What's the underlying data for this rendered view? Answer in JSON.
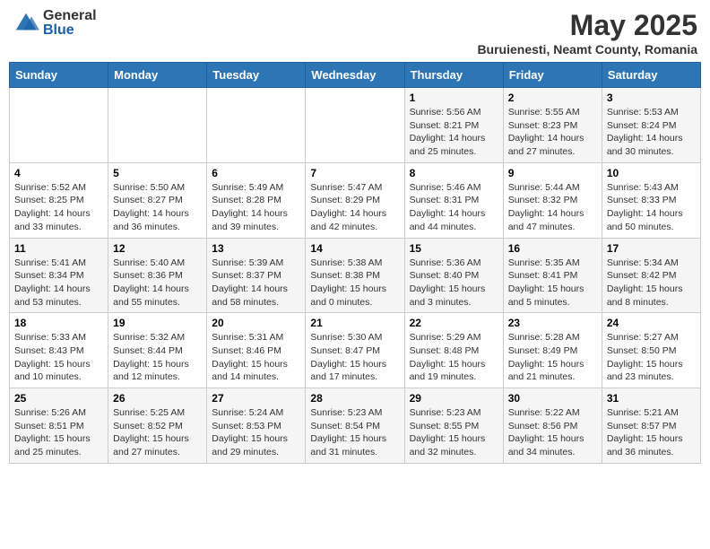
{
  "header": {
    "logo_general": "General",
    "logo_blue": "Blue",
    "month_title": "May 2025",
    "subtitle": "Buruienesti, Neamt County, Romania"
  },
  "days_of_week": [
    "Sunday",
    "Monday",
    "Tuesday",
    "Wednesday",
    "Thursday",
    "Friday",
    "Saturday"
  ],
  "weeks": [
    [
      {
        "day": "",
        "info": ""
      },
      {
        "day": "",
        "info": ""
      },
      {
        "day": "",
        "info": ""
      },
      {
        "day": "",
        "info": ""
      },
      {
        "day": "1",
        "info": "Sunrise: 5:56 AM\nSunset: 8:21 PM\nDaylight: 14 hours\nand 25 minutes."
      },
      {
        "day": "2",
        "info": "Sunrise: 5:55 AM\nSunset: 8:23 PM\nDaylight: 14 hours\nand 27 minutes."
      },
      {
        "day": "3",
        "info": "Sunrise: 5:53 AM\nSunset: 8:24 PM\nDaylight: 14 hours\nand 30 minutes."
      }
    ],
    [
      {
        "day": "4",
        "info": "Sunrise: 5:52 AM\nSunset: 8:25 PM\nDaylight: 14 hours\nand 33 minutes."
      },
      {
        "day": "5",
        "info": "Sunrise: 5:50 AM\nSunset: 8:27 PM\nDaylight: 14 hours\nand 36 minutes."
      },
      {
        "day": "6",
        "info": "Sunrise: 5:49 AM\nSunset: 8:28 PM\nDaylight: 14 hours\nand 39 minutes."
      },
      {
        "day": "7",
        "info": "Sunrise: 5:47 AM\nSunset: 8:29 PM\nDaylight: 14 hours\nand 42 minutes."
      },
      {
        "day": "8",
        "info": "Sunrise: 5:46 AM\nSunset: 8:31 PM\nDaylight: 14 hours\nand 44 minutes."
      },
      {
        "day": "9",
        "info": "Sunrise: 5:44 AM\nSunset: 8:32 PM\nDaylight: 14 hours\nand 47 minutes."
      },
      {
        "day": "10",
        "info": "Sunrise: 5:43 AM\nSunset: 8:33 PM\nDaylight: 14 hours\nand 50 minutes."
      }
    ],
    [
      {
        "day": "11",
        "info": "Sunrise: 5:41 AM\nSunset: 8:34 PM\nDaylight: 14 hours\nand 53 minutes."
      },
      {
        "day": "12",
        "info": "Sunrise: 5:40 AM\nSunset: 8:36 PM\nDaylight: 14 hours\nand 55 minutes."
      },
      {
        "day": "13",
        "info": "Sunrise: 5:39 AM\nSunset: 8:37 PM\nDaylight: 14 hours\nand 58 minutes."
      },
      {
        "day": "14",
        "info": "Sunrise: 5:38 AM\nSunset: 8:38 PM\nDaylight: 15 hours\nand 0 minutes."
      },
      {
        "day": "15",
        "info": "Sunrise: 5:36 AM\nSunset: 8:40 PM\nDaylight: 15 hours\nand 3 minutes."
      },
      {
        "day": "16",
        "info": "Sunrise: 5:35 AM\nSunset: 8:41 PM\nDaylight: 15 hours\nand 5 minutes."
      },
      {
        "day": "17",
        "info": "Sunrise: 5:34 AM\nSunset: 8:42 PM\nDaylight: 15 hours\nand 8 minutes."
      }
    ],
    [
      {
        "day": "18",
        "info": "Sunrise: 5:33 AM\nSunset: 8:43 PM\nDaylight: 15 hours\nand 10 minutes."
      },
      {
        "day": "19",
        "info": "Sunrise: 5:32 AM\nSunset: 8:44 PM\nDaylight: 15 hours\nand 12 minutes."
      },
      {
        "day": "20",
        "info": "Sunrise: 5:31 AM\nSunset: 8:46 PM\nDaylight: 15 hours\nand 14 minutes."
      },
      {
        "day": "21",
        "info": "Sunrise: 5:30 AM\nSunset: 8:47 PM\nDaylight: 15 hours\nand 17 minutes."
      },
      {
        "day": "22",
        "info": "Sunrise: 5:29 AM\nSunset: 8:48 PM\nDaylight: 15 hours\nand 19 minutes."
      },
      {
        "day": "23",
        "info": "Sunrise: 5:28 AM\nSunset: 8:49 PM\nDaylight: 15 hours\nand 21 minutes."
      },
      {
        "day": "24",
        "info": "Sunrise: 5:27 AM\nSunset: 8:50 PM\nDaylight: 15 hours\nand 23 minutes."
      }
    ],
    [
      {
        "day": "25",
        "info": "Sunrise: 5:26 AM\nSunset: 8:51 PM\nDaylight: 15 hours\nand 25 minutes."
      },
      {
        "day": "26",
        "info": "Sunrise: 5:25 AM\nSunset: 8:52 PM\nDaylight: 15 hours\nand 27 minutes."
      },
      {
        "day": "27",
        "info": "Sunrise: 5:24 AM\nSunset: 8:53 PM\nDaylight: 15 hours\nand 29 minutes."
      },
      {
        "day": "28",
        "info": "Sunrise: 5:23 AM\nSunset: 8:54 PM\nDaylight: 15 hours\nand 31 minutes."
      },
      {
        "day": "29",
        "info": "Sunrise: 5:23 AM\nSunset: 8:55 PM\nDaylight: 15 hours\nand 32 minutes."
      },
      {
        "day": "30",
        "info": "Sunrise: 5:22 AM\nSunset: 8:56 PM\nDaylight: 15 hours\nand 34 minutes."
      },
      {
        "day": "31",
        "info": "Sunrise: 5:21 AM\nSunset: 8:57 PM\nDaylight: 15 hours\nand 36 minutes."
      }
    ]
  ]
}
